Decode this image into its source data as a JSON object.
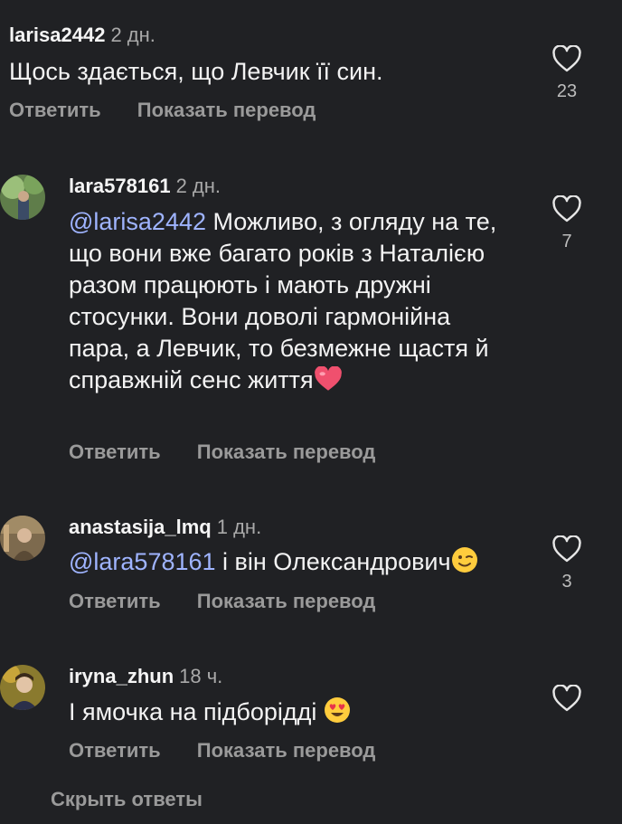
{
  "actions": {
    "reply": "Ответить",
    "translate": "Показать перевод"
  },
  "comments": [
    {
      "username": "larisa2442",
      "time": "2 дн.",
      "mention": "",
      "text": "Щось здається, що Левчик її син.",
      "likes": "23"
    },
    {
      "username": "lara578161",
      "time": "2 дн.",
      "mention": "@larisa2442",
      "text": " Можливо, з огляду на те, що вони  вже багато років з Наталією  разом  працюють і мають дружні стосунки. Вони доволі гармонійна пара, а Левчик, то безмежне щастя  й  справжній сенс життя",
      "emoji": "heart-emoji",
      "likes": "7"
    },
    {
      "username": "anastasija_lmq",
      "time": "1 дн.",
      "mention": "@lara578161",
      "text": " і він Олександрович",
      "emoji": "wink-emoji",
      "likes": "3"
    },
    {
      "username": "iryna_zhun",
      "time": "18 ч.",
      "mention": "",
      "text": "І ямочка на підборідді ",
      "emoji": "heart-eyes-emoji",
      "likes": ""
    }
  ],
  "hide_replies": "Скрыть ответы",
  "colors": {
    "background": "#202124",
    "mention": "#9fb4ff",
    "muted": "#9a9a9a"
  }
}
